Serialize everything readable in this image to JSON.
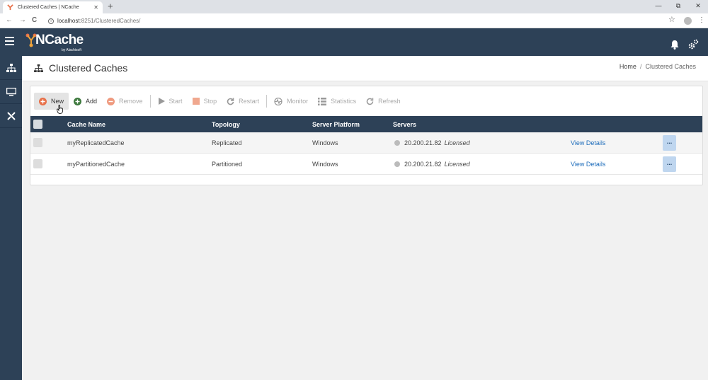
{
  "browser": {
    "tab_title": "Clustered Caches | NCache",
    "tab_close": "✕",
    "new_tab": "+",
    "back": "←",
    "forward": "→",
    "reload": "C",
    "url_host": "localhost",
    "url_path": ":8251/ClusteredCaches/",
    "window_minimize": "—",
    "window_restore": "⧉",
    "window_close": "✕"
  },
  "header": {
    "logo_text": "NCache",
    "logo_sub": "by Alachisoft"
  },
  "page": {
    "title": "Clustered Caches",
    "breadcrumb_home": "Home",
    "breadcrumb_sep": "/",
    "breadcrumb_current": "Clustered Caches"
  },
  "toolbar": {
    "new": "New",
    "add": "Add",
    "remove": "Remove",
    "start": "Start",
    "stop": "Stop",
    "restart": "Restart",
    "monitor": "Monitor",
    "statistics": "Statistics",
    "refresh": "Refresh"
  },
  "table": {
    "columns": [
      "Cache Name",
      "Topology",
      "Server Platform",
      "Servers"
    ],
    "rows": [
      {
        "name": "myReplicatedCache",
        "topology": "Replicated",
        "platform": "Windows",
        "server": "20.200.21.82",
        "license": "Licensed",
        "details": "View Details",
        "more": "..."
      },
      {
        "name": "myPartitionedCache",
        "topology": "Partitioned",
        "platform": "Windows",
        "server": "20.200.21.82",
        "license": "Licensed",
        "details": "View Details",
        "more": "..."
      }
    ]
  },
  "colors": {
    "header_bg": "#2d4157",
    "accent_new": "#e8714a",
    "accent_add": "#3f7a3f",
    "link": "#1e6dbb"
  }
}
